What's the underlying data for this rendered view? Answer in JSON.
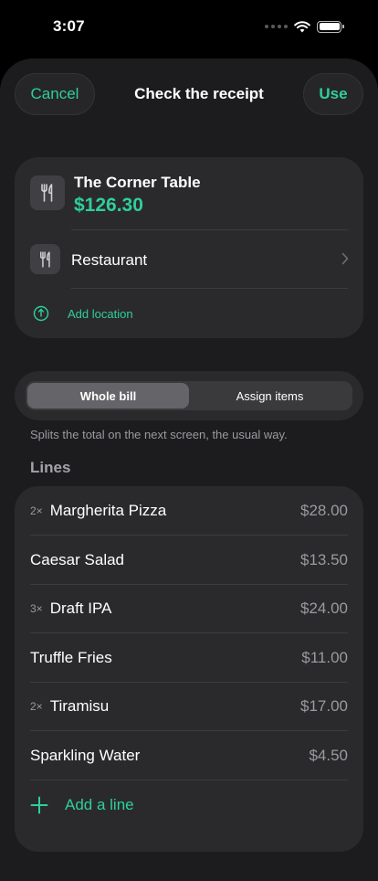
{
  "status_bar": {
    "time": "3:07"
  },
  "nav": {
    "cancel_label": "Cancel",
    "title": "Check the receipt",
    "use_label": "Use"
  },
  "merchant": {
    "name": "The Corner Table",
    "total": "$126.30",
    "category": "Restaurant",
    "location_label": "Add location",
    "icons": {
      "merchant": "fork-knife-icon",
      "category": "fork-knife-icon",
      "location": "location-pin-icon",
      "chevron": "chevron-right-icon"
    }
  },
  "split_mode": {
    "options": [
      "Whole bill",
      "Assign items"
    ],
    "selected": "Whole bill",
    "hint": "Splits the total on the next screen, the usual way."
  },
  "lines": {
    "section_label": "Lines",
    "items": [
      {
        "qty": "2×",
        "name": "Margherita Pizza",
        "price": "$28.00"
      },
      {
        "qty": "",
        "name": "Caesar Salad",
        "price": "$13.50"
      },
      {
        "qty": "3×",
        "name": "Draft IPA",
        "price": "$24.00"
      },
      {
        "qty": "",
        "name": "Truffle Fries",
        "price": "$11.00"
      },
      {
        "qty": "2×",
        "name": "Tiramisu",
        "price": "$17.00"
      },
      {
        "qty": "",
        "name": "Sparkling Water",
        "price": "$4.50"
      }
    ],
    "add_label": "Add a line"
  },
  "colors": {
    "accent": "#2fcf9a",
    "background": "#1c1c1e",
    "card": "#2a2a2c"
  }
}
